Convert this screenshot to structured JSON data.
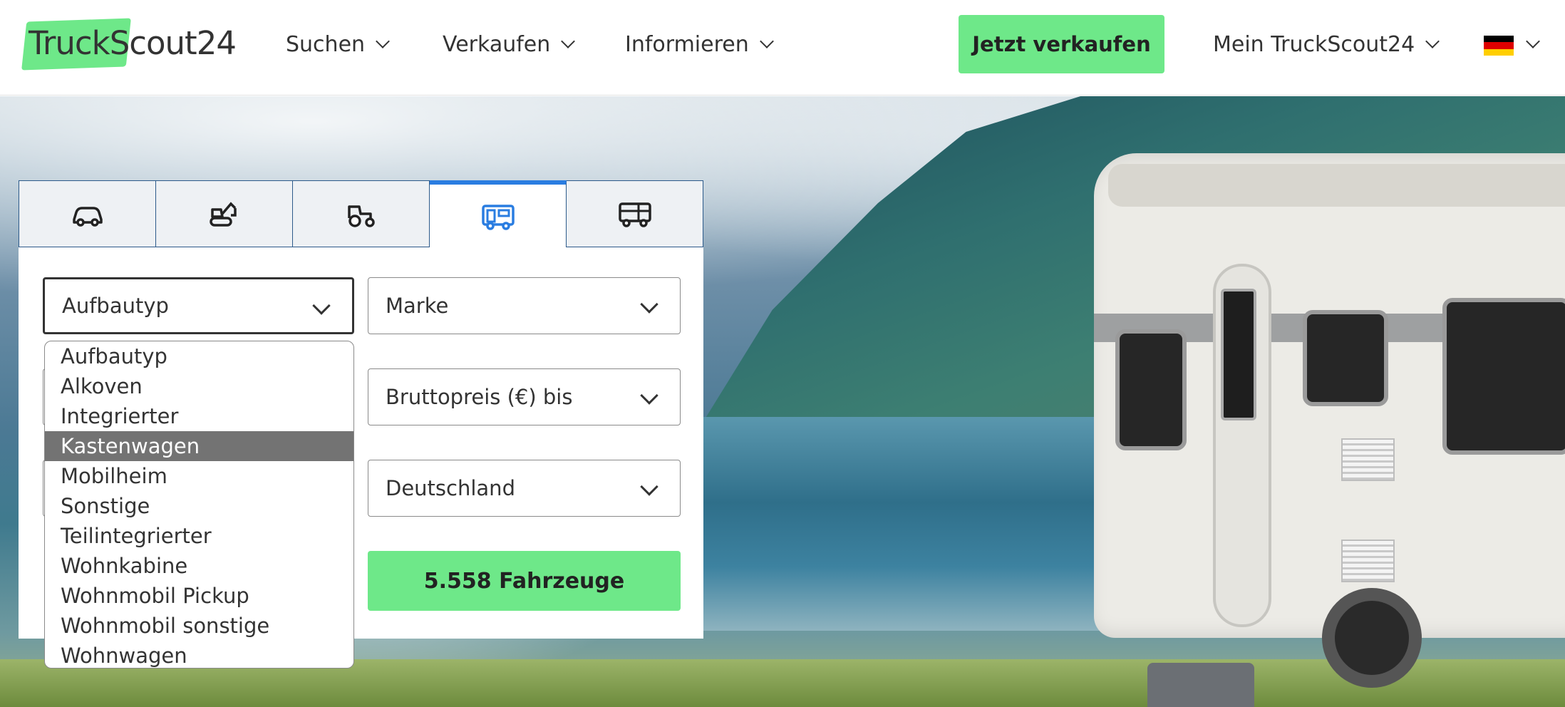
{
  "header": {
    "logo_part1": "Truck",
    "logo_part2": "Scout24",
    "nav": [
      {
        "label": "Suchen"
      },
      {
        "label": "Verkaufen"
      },
      {
        "label": "Informieren"
      }
    ],
    "sell_button": "Jetzt verkaufen",
    "account": "Mein TruckScout24",
    "language_flag": "de-flag-icon"
  },
  "search": {
    "tabs": [
      {
        "name": "car-icon",
        "active": false
      },
      {
        "name": "construction-machine-icon",
        "active": false
      },
      {
        "name": "tractor-icon",
        "active": false
      },
      {
        "name": "motorhome-icon",
        "active": true
      },
      {
        "name": "truck-icon",
        "active": false
      }
    ],
    "body_type": "Aufbautyp",
    "brand": "Marke",
    "price": "Bruttopreis (€) bis",
    "country": "Deutschland",
    "results_button": "5.558 Fahrzeuge",
    "dropdown_options": [
      "Aufbautyp",
      "Alkoven",
      "Integrierter",
      "Kastenwagen",
      "Mobilheim",
      "Sonstige",
      "Teilintegrierter",
      "Wohnkabine",
      "Wohnmobil Pickup",
      "Wohnmobil sonstige",
      "Wohnwagen"
    ],
    "dropdown_highlighted": "Kastenwagen"
  },
  "colors": {
    "accent_green": "#6ee889",
    "tab_active_blue": "#2a7de1",
    "highlight_grey": "#737373"
  }
}
